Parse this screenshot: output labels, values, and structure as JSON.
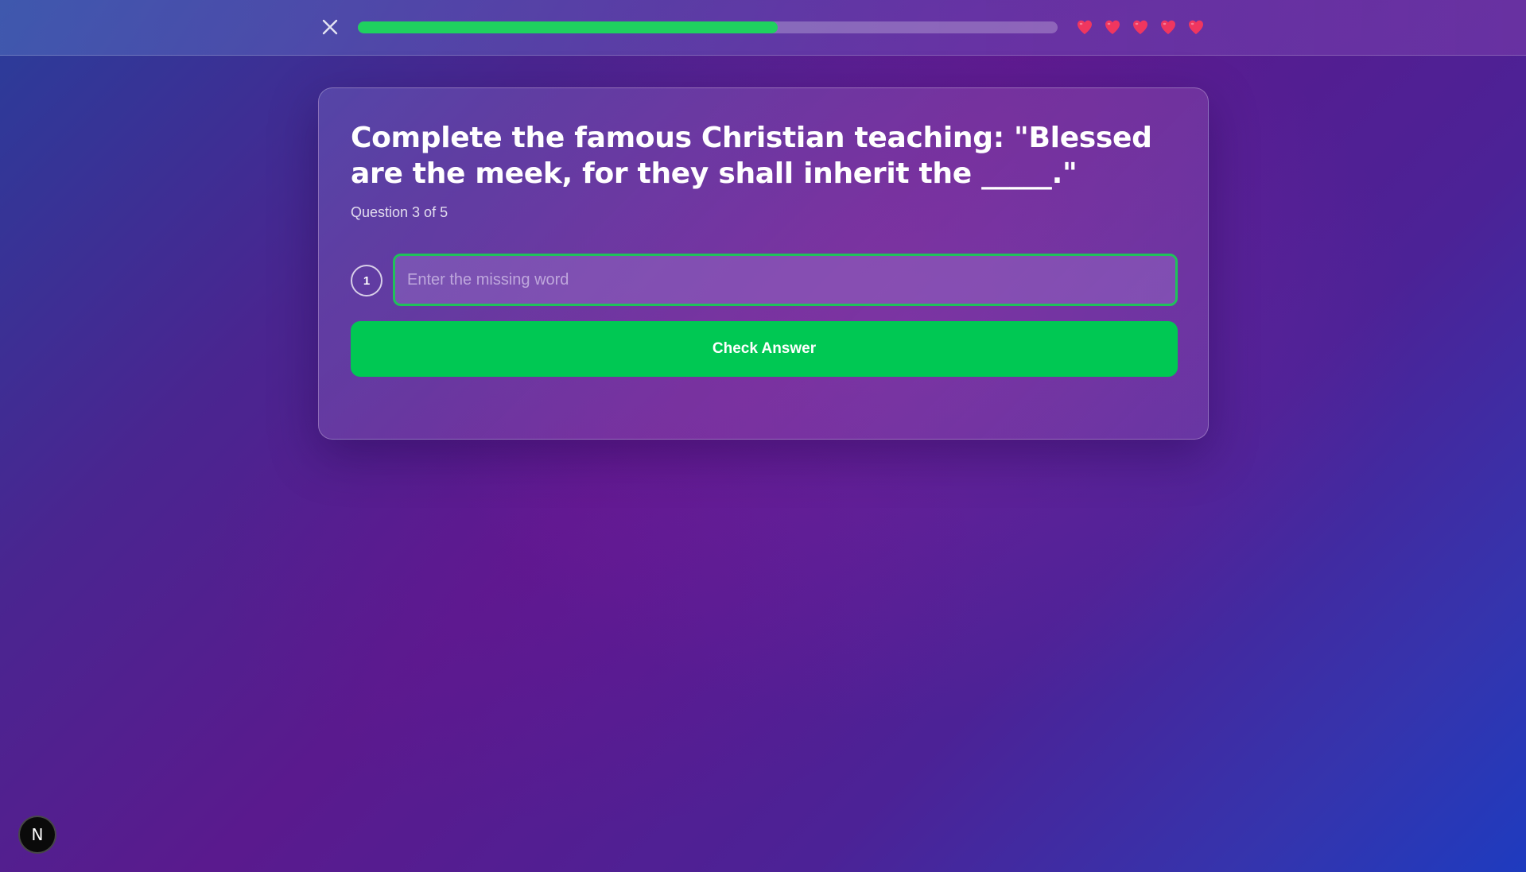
{
  "header": {
    "close_icon": "close-icon",
    "progress_percent": 60,
    "progress_color": "#1fd15f",
    "hearts": [
      {
        "icon": "heart-icon",
        "color": "#f0365f"
      },
      {
        "icon": "heart-icon",
        "color": "#f0365f"
      },
      {
        "icon": "heart-icon",
        "color": "#f0365f"
      },
      {
        "icon": "heart-icon",
        "color": "#f0365f"
      },
      {
        "icon": "heart-icon",
        "color": "#f0365f"
      }
    ]
  },
  "quiz": {
    "question": "Complete the famous Christian teaching: \"Blessed are the meek, for they shall inherit the _____.\"",
    "counter": "Question 3 of 5",
    "blank_number": "1",
    "input_value": "",
    "input_placeholder": "Enter the missing word",
    "check_button_label": "Check Answer",
    "check_button_color": "#00c853"
  },
  "badge": {
    "label": "N",
    "icon": "nextjs-logo-icon"
  }
}
